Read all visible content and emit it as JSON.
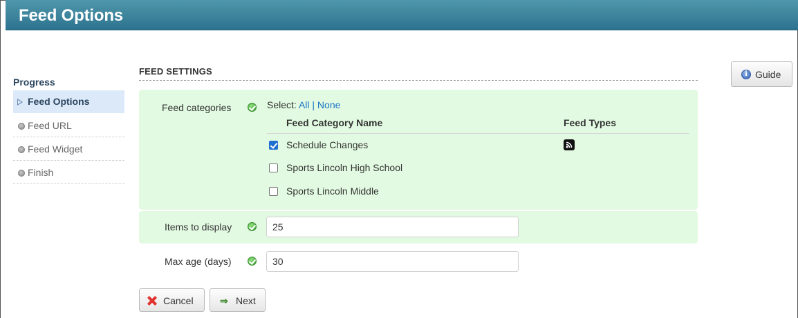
{
  "header": {
    "title": "Feed Options"
  },
  "sidebar": {
    "title": "Progress",
    "items": [
      {
        "label": "Feed Options",
        "active": true
      },
      {
        "label": "Feed URL",
        "active": false
      },
      {
        "label": "Feed Widget",
        "active": false
      },
      {
        "label": "Finish",
        "active": false
      }
    ]
  },
  "section": {
    "title": "FEED SETTINGS"
  },
  "feed_categories": {
    "label": "Feed categories",
    "select_prefix": "Select:",
    "select_all": "All",
    "select_separator": "|",
    "select_none": "None",
    "columns": [
      "Feed Category Name",
      "Feed Types"
    ],
    "rows": [
      {
        "name": "Schedule Changes",
        "checked": true,
        "feed_type_icon": "rss-icon"
      },
      {
        "name": "Sports Lincoln High School",
        "checked": false
      },
      {
        "name": "Sports Lincoln Middle",
        "checked": false
      }
    ]
  },
  "items_to_display": {
    "label": "Items to display",
    "value": "25"
  },
  "max_age": {
    "label": "Max age (days)",
    "value": "30"
  },
  "buttons": {
    "cancel": "Cancel",
    "next": "Next",
    "guide": "Guide"
  },
  "icons": {
    "valid": "check-circle-icon",
    "cancel": "x-icon",
    "next": "arrow-right-icon",
    "guide": "info-icon",
    "feed_type": "rss-icon"
  },
  "colors": {
    "header": "#3a849e",
    "highlight": "#e2fae2",
    "sidebar_active": "#dbe9f8",
    "link": "#1a73c4"
  }
}
